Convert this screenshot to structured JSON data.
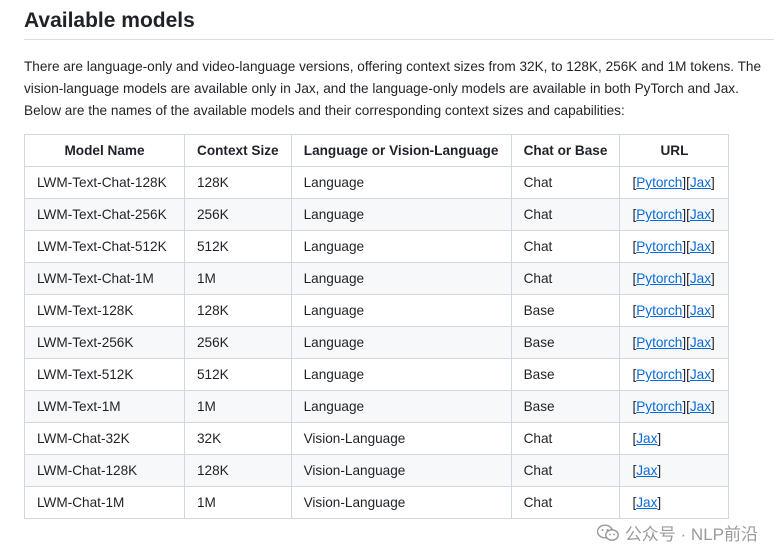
{
  "heading": "Available models",
  "intro": "There are language-only and video-language versions, offering context sizes from 32K, to 128K, 256K and 1M tokens. The vision-language models are available only in Jax, and the language-only models are available in both PyTorch and Jax. Below are the names of the available models and their corresponding context sizes and capabilities:",
  "table": {
    "headers": [
      "Model Name",
      "Context Size",
      "Language or Vision-Language",
      "Chat or Base",
      "URL"
    ],
    "rows": [
      {
        "name": "LWM-Text-Chat-128K",
        "context": "128K",
        "modality": "Language",
        "type": "Chat",
        "pytorch": "Pytorch",
        "jax": "Jax"
      },
      {
        "name": "LWM-Text-Chat-256K",
        "context": "256K",
        "modality": "Language",
        "type": "Chat",
        "pytorch": "Pytorch",
        "jax": "Jax"
      },
      {
        "name": "LWM-Text-Chat-512K",
        "context": "512K",
        "modality": "Language",
        "type": "Chat",
        "pytorch": "Pytorch",
        "jax": "Jax"
      },
      {
        "name": "LWM-Text-Chat-1M",
        "context": "1M",
        "modality": "Language",
        "type": "Chat",
        "pytorch": "Pytorch",
        "jax": "Jax"
      },
      {
        "name": "LWM-Text-128K",
        "context": "128K",
        "modality": "Language",
        "type": "Base",
        "pytorch": "Pytorch",
        "jax": "Jax"
      },
      {
        "name": "LWM-Text-256K",
        "context": "256K",
        "modality": "Language",
        "type": "Base",
        "pytorch": "Pytorch",
        "jax": "Jax"
      },
      {
        "name": "LWM-Text-512K",
        "context": "512K",
        "modality": "Language",
        "type": "Base",
        "pytorch": "Pytorch",
        "jax": "Jax"
      },
      {
        "name": "LWM-Text-1M",
        "context": "1M",
        "modality": "Language",
        "type": "Base",
        "pytorch": "Pytorch",
        "jax": "Jax"
      },
      {
        "name": "LWM-Chat-32K",
        "context": "32K",
        "modality": "Vision-Language",
        "type": "Chat",
        "pytorch": null,
        "jax": "Jax"
      },
      {
        "name": "LWM-Chat-128K",
        "context": "128K",
        "modality": "Vision-Language",
        "type": "Chat",
        "pytorch": null,
        "jax": "Jax"
      },
      {
        "name": "LWM-Chat-1M",
        "context": "1M",
        "modality": "Vision-Language",
        "type": "Chat",
        "pytorch": null,
        "jax": "Jax"
      }
    ]
  },
  "watermark": "公众号 · NLP前沿",
  "colors": {
    "link": "#0969da",
    "border": "#d0d7de",
    "stripe": "#f6f8fa",
    "text": "#1f2328"
  }
}
